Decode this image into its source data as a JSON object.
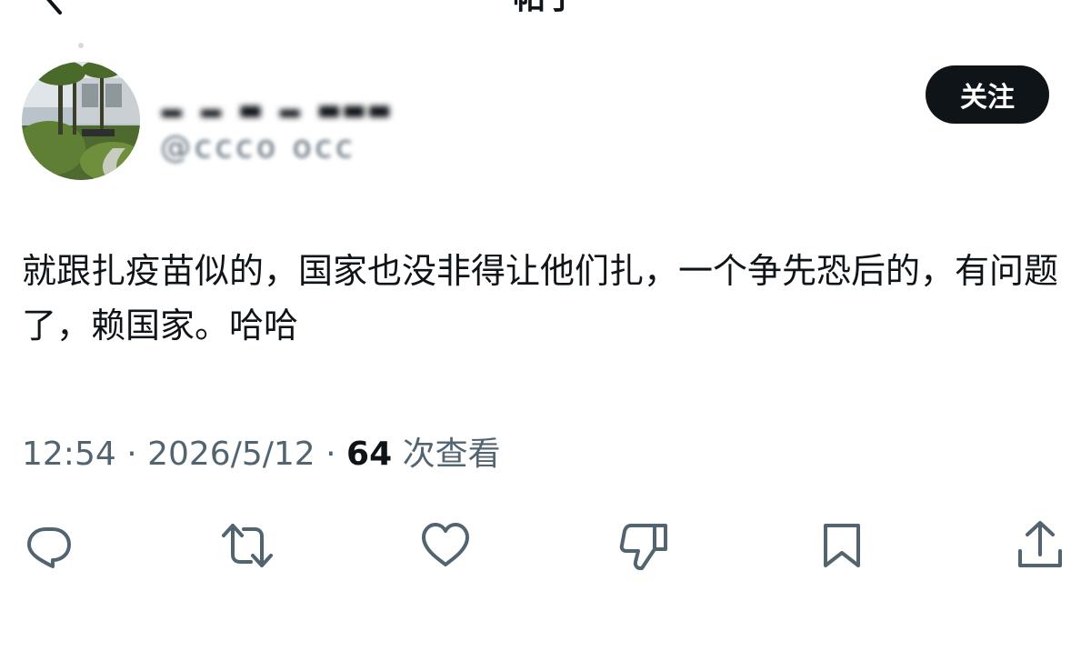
{
  "header": {
    "back_icon": "chevron-left-icon",
    "title": "帖子"
  },
  "author": {
    "display_name": "▂ ▂ ▃ ▂ ▃▃▃",
    "handle": "@ccco occ",
    "follow_label": "关注"
  },
  "post": {
    "text": "就跟扎疫苗似的，国家也没非得让他们扎，一个争先恐后的，有问题了，赖国家。哈哈"
  },
  "meta": {
    "time": "12:54",
    "sep1": " · ",
    "date": "2026/5/12",
    "sep2": " · ",
    "views": "64",
    "views_label": " 次查看"
  },
  "actions": {
    "icons": [
      "reply-icon",
      "retweet-icon",
      "like-icon",
      "dislike-icon",
      "bookmark-icon",
      "share-icon"
    ]
  },
  "colors": {
    "text_primary": "#0f1419",
    "text_secondary": "#536471",
    "icon": "#536471",
    "button_bg": "#0f1419",
    "button_text": "#ffffff"
  }
}
